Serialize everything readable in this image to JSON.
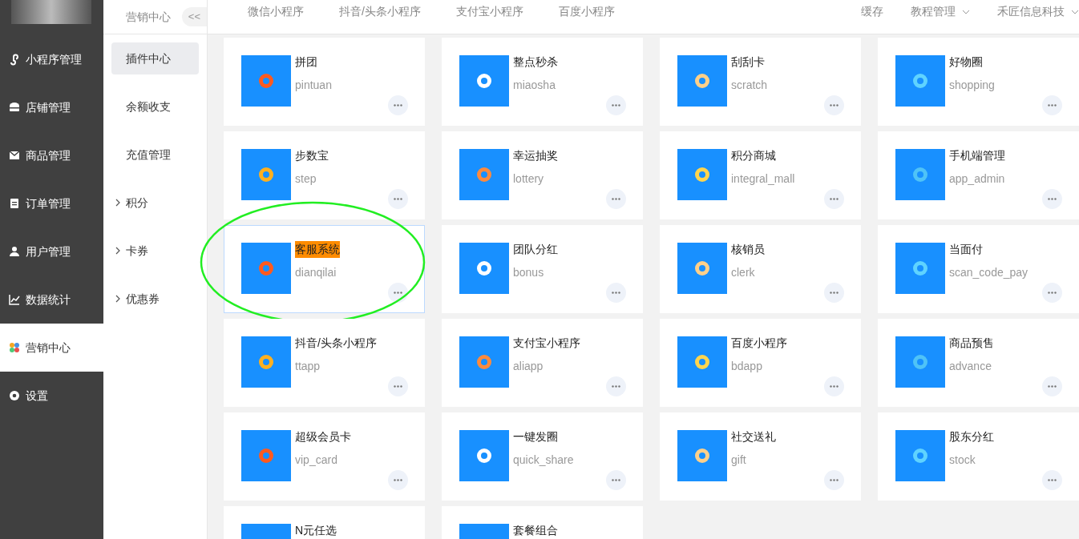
{
  "sidebar": {
    "items": [
      {
        "label": "小程序管理",
        "selected": false
      },
      {
        "label": "店铺管理",
        "selected": false
      },
      {
        "label": "商品管理",
        "selected": false
      },
      {
        "label": "订单管理",
        "selected": false
      },
      {
        "label": "用户管理",
        "selected": false
      },
      {
        "label": "数据统计",
        "selected": false
      },
      {
        "label": "营销中心",
        "selected": true
      },
      {
        "label": "设置",
        "selected": false
      }
    ]
  },
  "submenu": {
    "title": "营销中心",
    "collapse": "<<",
    "items": [
      {
        "label": "插件中心",
        "expandable": false,
        "selected": true
      },
      {
        "label": "余额收支",
        "expandable": false,
        "selected": false
      },
      {
        "label": "充值管理",
        "expandable": false,
        "selected": false
      },
      {
        "label": "积分",
        "expandable": true,
        "selected": false
      },
      {
        "label": "卡券",
        "expandable": true,
        "selected": false
      },
      {
        "label": "优惠券",
        "expandable": true,
        "selected": false
      }
    ]
  },
  "top_nav": {
    "tabs": [
      "微信小程序",
      "抖音/头条小程序",
      "支付宝小程序",
      "百度小程序"
    ],
    "right": [
      {
        "label": "缓存",
        "dropdown": false
      },
      {
        "label": "教程管理",
        "dropdown": true
      },
      {
        "label": "禾匠信息科技",
        "dropdown": true
      }
    ]
  },
  "plugins": [
    {
      "title": "拼团",
      "name": "pintuan",
      "selected": false,
      "highlighted": false,
      "circled": false
    },
    {
      "title": "整点秒杀",
      "name": "miaosha",
      "selected": false,
      "highlighted": false,
      "circled": false
    },
    {
      "title": "刮刮卡",
      "name": "scratch",
      "selected": false,
      "highlighted": false,
      "circled": false
    },
    {
      "title": "好物圈",
      "name": "shopping",
      "selected": false,
      "highlighted": false,
      "circled": false
    },
    {
      "title": "步数宝",
      "name": "step",
      "selected": false,
      "highlighted": false,
      "circled": false
    },
    {
      "title": "幸运抽奖",
      "name": "lottery",
      "selected": false,
      "highlighted": false,
      "circled": false
    },
    {
      "title": "积分商城",
      "name": "integral_mall",
      "selected": false,
      "highlighted": false,
      "circled": false
    },
    {
      "title": "手机端管理",
      "name": "app_admin",
      "selected": false,
      "highlighted": false,
      "circled": false
    },
    {
      "title": "客服系统",
      "name": "dianqilai",
      "selected": true,
      "highlighted": true,
      "circled": true
    },
    {
      "title": "团队分红",
      "name": "bonus",
      "selected": false,
      "highlighted": false,
      "circled": false
    },
    {
      "title": "核销员",
      "name": "clerk",
      "selected": false,
      "highlighted": false,
      "circled": false
    },
    {
      "title": "当面付",
      "name": "scan_code_pay",
      "selected": false,
      "highlighted": false,
      "circled": false
    },
    {
      "title": "抖音/头条小程序",
      "name": "ttapp",
      "selected": false,
      "highlighted": false,
      "circled": false
    },
    {
      "title": "支付宝小程序",
      "name": "aliapp",
      "selected": false,
      "highlighted": false,
      "circled": false
    },
    {
      "title": "百度小程序",
      "name": "bdapp",
      "selected": false,
      "highlighted": false,
      "circled": false
    },
    {
      "title": "商品预售",
      "name": "advance",
      "selected": false,
      "highlighted": false,
      "circled": false
    },
    {
      "title": "超级会员卡",
      "name": "vip_card",
      "selected": false,
      "highlighted": false,
      "circled": false
    },
    {
      "title": "一键发圈",
      "name": "quick_share",
      "selected": false,
      "highlighted": false,
      "circled": false
    },
    {
      "title": "社交送礼",
      "name": "gift",
      "selected": false,
      "highlighted": false,
      "circled": false
    },
    {
      "title": "股东分红",
      "name": "stock",
      "selected": false,
      "highlighted": false,
      "circled": false
    },
    {
      "title": "N元任选",
      "selected": false,
      "highlighted": false,
      "circled": false
    },
    {
      "title": "套餐组合",
      "selected": false,
      "highlighted": false,
      "circled": false
    }
  ]
}
